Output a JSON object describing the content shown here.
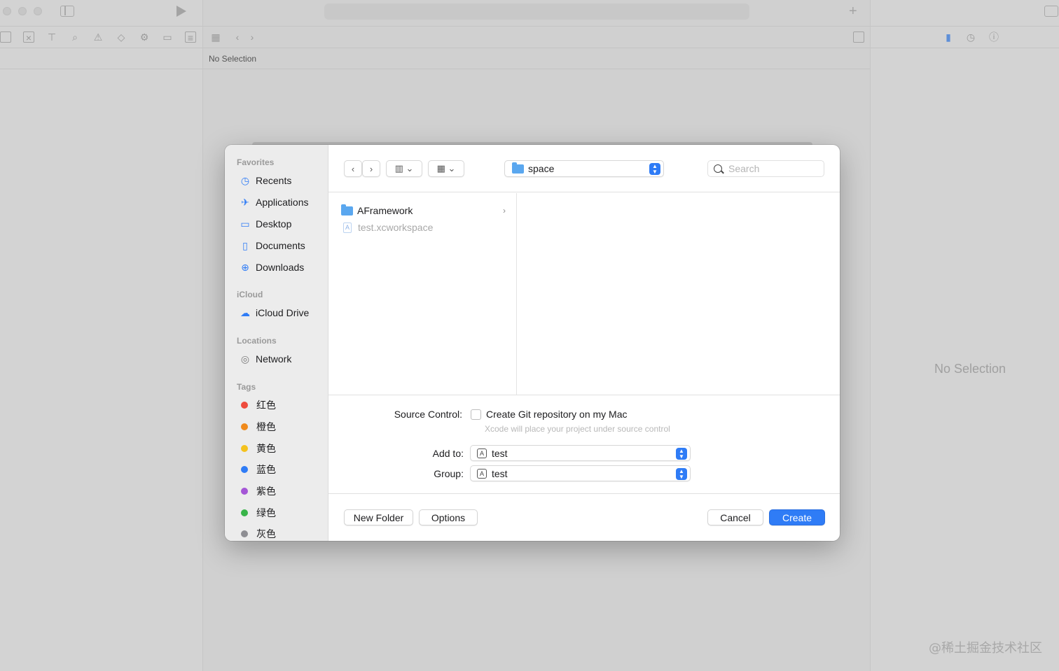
{
  "xcode": {
    "breadcrumb": "No Selection",
    "inspector_empty": "No Selection",
    "watermark": "@稀土掘金技术社区"
  },
  "dialog": {
    "location": "space",
    "search_placeholder": "Search",
    "sidebar": {
      "favorites_title": "Favorites",
      "favorites": [
        {
          "label": "Recents",
          "icon": "clock-icon"
        },
        {
          "label": "Applications",
          "icon": "applications-icon"
        },
        {
          "label": "Desktop",
          "icon": "desktop-icon"
        },
        {
          "label": "Documents",
          "icon": "document-icon"
        },
        {
          "label": "Downloads",
          "icon": "download-icon"
        }
      ],
      "icloud_title": "iCloud",
      "icloud": [
        {
          "label": "iCloud Drive",
          "icon": "cloud-icon"
        }
      ],
      "locations_title": "Locations",
      "locations": [
        {
          "label": "Network",
          "icon": "globe-icon"
        }
      ],
      "tags_title": "Tags",
      "tags": [
        {
          "label": "红色",
          "color": "#ee4b3d"
        },
        {
          "label": "橙色",
          "color": "#f08a1c"
        },
        {
          "label": "黄色",
          "color": "#f4c21e"
        },
        {
          "label": "蓝色",
          "color": "#2f7cf6"
        },
        {
          "label": "紫色",
          "color": "#a456d6"
        },
        {
          "label": "绿色",
          "color": "#38b449"
        },
        {
          "label": "灰色",
          "color": "#8e8e93"
        }
      ]
    },
    "files": [
      {
        "name": "AFramework",
        "type": "folder"
      },
      {
        "name": "test.xcworkspace",
        "type": "workspace"
      }
    ],
    "source_control_label": "Source Control:",
    "git_checkbox_label": "Create Git repository on my Mac",
    "git_hint": "Xcode will place your project under source control",
    "add_to_label": "Add to:",
    "add_to_value": "test",
    "group_label": "Group:",
    "group_value": "test",
    "buttons": {
      "new_folder": "New Folder",
      "options": "Options",
      "cancel": "Cancel",
      "create": "Create"
    }
  }
}
